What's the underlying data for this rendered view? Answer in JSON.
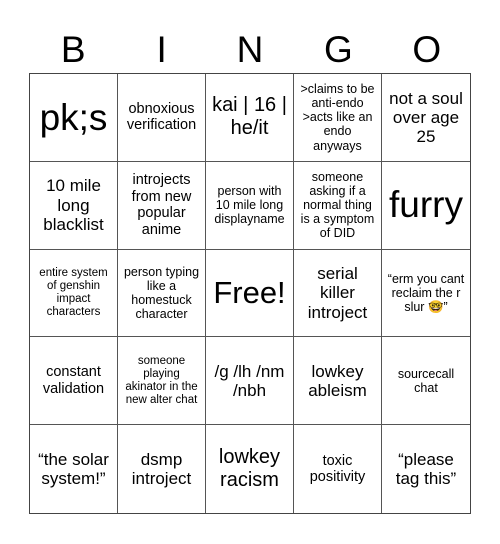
{
  "title_letters": [
    "B",
    "I",
    "N",
    "G",
    "O"
  ],
  "cells": [
    {
      "text": "pk;s",
      "size": "s-xl"
    },
    {
      "text": "obnoxious verification",
      "size": "s-sm"
    },
    {
      "text": "kai | 16 | he/it",
      "size": "s-ml"
    },
    {
      "text": ">claims to be anti-endo >acts like an endo anyways",
      "size": "s-s"
    },
    {
      "text": "not a soul over age 25",
      "size": "s-m"
    },
    {
      "text": "10 mile long blacklist",
      "size": "s-m"
    },
    {
      "text": "introjects from new popular anime",
      "size": "s-sm"
    },
    {
      "text": "person with 10 mile long displayname",
      "size": "s-s"
    },
    {
      "text": "someone asking if a normal thing is a symptom of DID",
      "size": "s-s"
    },
    {
      "text": "furry",
      "size": "s-xl"
    },
    {
      "text": "entire system of genshin impact characters",
      "size": "s-xs"
    },
    {
      "text": "person typing like a homestuck character",
      "size": "s-s"
    },
    {
      "text": "Free!",
      "size": "free"
    },
    {
      "text": "serial killer introject",
      "size": "s-m"
    },
    {
      "text": "“erm you cant reclaim the r slur 🤓”",
      "size": "s-s"
    },
    {
      "text": "constant validation",
      "size": "s-sm"
    },
    {
      "text": "someone playing akinator in the new alter chat",
      "size": "s-xs"
    },
    {
      "text": "/g /lh /nm /nbh",
      "size": "s-m"
    },
    {
      "text": "lowkey ableism",
      "size": "s-m"
    },
    {
      "text": "sourcecall chat",
      "size": "s-s"
    },
    {
      "text": "“the solar system!”",
      "size": "s-m"
    },
    {
      "text": "dsmp introject",
      "size": "s-m"
    },
    {
      "text": "lowkey racism",
      "size": "s-ml"
    },
    {
      "text": "toxic positivity",
      "size": "s-sm"
    },
    {
      "text": "“please tag this”",
      "size": "s-m"
    }
  ]
}
